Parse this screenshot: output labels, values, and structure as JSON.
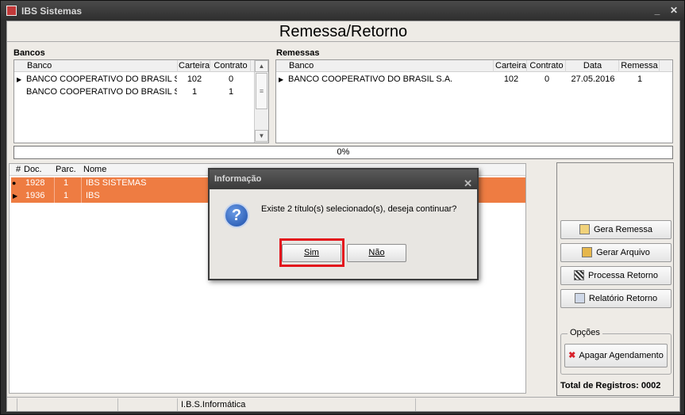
{
  "window": {
    "title": "IBS Sistemas",
    "min_label": "_",
    "close_label": "✕"
  },
  "heading": "Remessa/Retorno",
  "bancos": {
    "label": "Bancos",
    "columns": [
      "Banco",
      "Carteira",
      "Contrato"
    ],
    "rows": [
      {
        "banco": "BANCO COOPERATIVO DO BRASIL S",
        "carteira": "102",
        "contrato": "0"
      },
      {
        "banco": "BANCO COOPERATIVO DO BRASIL S",
        "carteira": "1",
        "contrato": "1"
      }
    ]
  },
  "remessas": {
    "label": "Remessas",
    "columns": [
      "Banco",
      "Carteira",
      "Contrato",
      "Data",
      "Remessa"
    ],
    "rows": [
      {
        "banco": "BANCO COOPERATIVO DO BRASIL S.A.",
        "carteira": "102",
        "contrato": "0",
        "data": "27.05.2016",
        "remessa": "1"
      }
    ]
  },
  "progress": {
    "text": "0%",
    "value": 0
  },
  "titulos": {
    "columns": [
      "#",
      "Doc.",
      "Parc.",
      "Nome"
    ],
    "rows": [
      {
        "doc": "1928",
        "parc": "1",
        "nome": "IBS SISTEMAS"
      },
      {
        "doc": "1936",
        "parc": "1",
        "nome": "IBS"
      }
    ]
  },
  "actions": {
    "gera_remessa": "Gera Remessa",
    "gerar_arquivo": "Gerar Arquivo",
    "processa_retorno": "Processa Retorno",
    "relatorio_retorno": "Relatório Retorno"
  },
  "opcoes": {
    "legend": "Opções",
    "apagar": "Apagar Agendamento"
  },
  "total": "Total de Registros: 0002",
  "statusbar": {
    "company": "I.B.S.Informática"
  },
  "dialog": {
    "title": "Informação",
    "close_label": "✕",
    "message": "Existe 2 título(s) selecionado(s), deseja continuar?",
    "yes": "Sim",
    "no": "Não",
    "icon": "question-icon"
  },
  "colors": {
    "selected_row": "#ee7c42",
    "highlight": "#e3141c",
    "titlebar": "#3a3a3a"
  }
}
